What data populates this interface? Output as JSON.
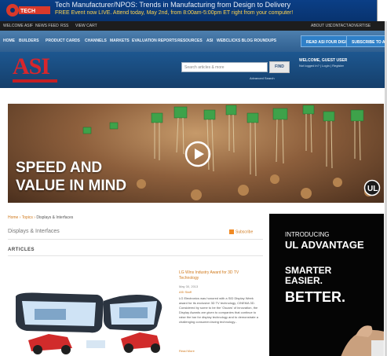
{
  "top_banner": {
    "line1": "Tech Manufacturer/NPOS: Trends in Manufacturing from Design to Delivery",
    "line2": "FREE Event now LIVE. Attend today, May 2nd, from 8:00am-5:00pm ET right from your computer!"
  },
  "utility_bar": {
    "left_items": [
      "WELCOME ASIF",
      "NEWS FEED",
      "RSS",
      "VIEW CART"
    ],
    "right_items": [
      "ABOUT US",
      "CONTACT",
      "ADVERTISE"
    ]
  },
  "nav": {
    "items": [
      "HOME",
      "BUILDERS",
      "PRODUCT CARDS",
      "CHANNELS",
      "MARKETS",
      "EVALUATION REPORTS",
      "RESOURCES",
      "ASI",
      "WEBCLICKS BLOG ROUNDUPS"
    ],
    "buttons": [
      "READ ASI FOUR DIGITAL",
      "SUBSCRIBE TO ASI"
    ]
  },
  "header": {
    "logo_text": "ASI",
    "search_placeholder": "Search articles & more",
    "search_button": "FIND",
    "search_note": "Advanced Search",
    "signin_title": "WELCOME, GUEST USER",
    "signin_sub": "Not logged in? | Login | Register"
  },
  "hero": {
    "headline_line1": "SPEED AND",
    "headline_line2": "VALUE IN MIND"
  },
  "breadcrumb": {
    "home": "Home",
    "sep1": " › ",
    "category": "Topics",
    "sep2": " › ",
    "current": "Displays & Interfaces"
  },
  "page_title": "Displays & Interfaces",
  "subscribe_label": "Subscribe",
  "section_label": "ARTICLES",
  "article": {
    "title": "LG Wins Industry Award for 3D TV Technology",
    "date": "May 30, 2013",
    "author": "ASI Staff",
    "body": "LG Electronics was honored with a SID Display Week award for its exclusive 3D TV technology, CINEMA 3D. Considered by some to be the 'Oscars' of innovation, the Display Awards are given to companies that continue to raise the bar for display technology and to demonstrate a challenging consumer-facing technology...",
    "more": "Read More"
  },
  "right_ad": {
    "line1": "INTRODUCING",
    "line2": "UL ADVANTAGE",
    "line3": "SMARTER",
    "line4": "EASIER.",
    "line5": "BETTER."
  },
  "colors": {
    "accent_orange": "#d0791c",
    "nav_blue": "#2f5f90",
    "logo_red": "#d8262c"
  }
}
